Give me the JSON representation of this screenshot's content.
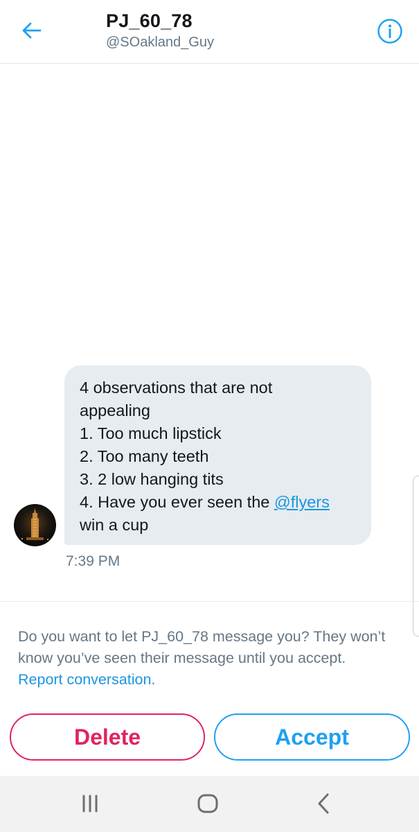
{
  "header": {
    "back_icon": "arrow-left-icon",
    "title": "PJ_60_78",
    "handle": "@SOakland_Guy",
    "info_icon": "info-circle-icon",
    "accent_color": "#1da1f2"
  },
  "message": {
    "lines": [
      "4 observations that are not",
      "appealing",
      "1. Too much lipstick",
      "2. Too many teeth",
      "3. 2 low hanging tits",
      "4. Have you ever seen the "
    ],
    "mention": "@flyers",
    "last_line": "win a cup",
    "time": "7:39 PM",
    "avatar": "avatar-tower-at-night",
    "bubble_color": "#e6ecf0"
  },
  "request": {
    "text": "Do you want to let PJ_60_78 message you? They won’t know you’ve seen their message until you accept. ",
    "report_link": "Report conversation.",
    "delete_label": "Delete",
    "accept_label": "Accept",
    "delete_color": "#e0245e",
    "accept_color": "#1da1f2"
  },
  "system_nav": {
    "recents_icon": "recents-icon",
    "home_icon": "home-icon",
    "back_icon": "back-chevron-icon"
  }
}
